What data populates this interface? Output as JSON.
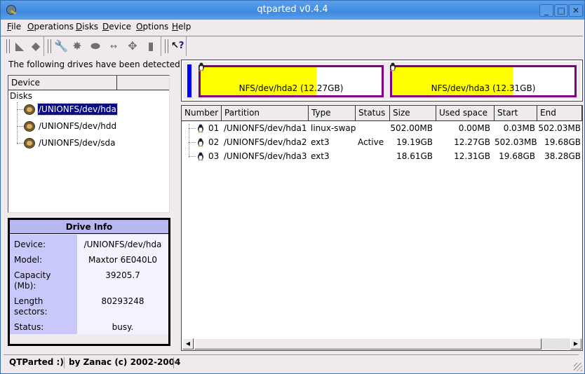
{
  "window": {
    "title": "qtparted v0.4.4",
    "controls": [
      "minimize",
      "maximize",
      "close"
    ]
  },
  "menubar": [
    {
      "label": "File",
      "mnemonic": "F",
      "rest": "ile"
    },
    {
      "label": "Operations",
      "mnemonic": "O",
      "rest": "perations"
    },
    {
      "label": "Disks",
      "mnemonic": "D",
      "rest": "isks"
    },
    {
      "label": "Device",
      "mnemonic": "D",
      "rest": "evice"
    },
    {
      "label": "Options",
      "mnemonic": "O",
      "rest": "ptions"
    },
    {
      "label": "Help",
      "mnemonic": "H",
      "rest": "elp"
    }
  ],
  "toolbar": {
    "groups": [
      [
        "undo-icon",
        "commit-icon"
      ],
      [
        "properties-icon",
        "create-icon",
        "format-icon",
        "resize-icon",
        "move-icon",
        "delete-icon"
      ],
      [
        "whats-this-icon"
      ]
    ]
  },
  "left": {
    "detected_label": "The following drives have been detected:",
    "tree_header": "Device",
    "tree_root": "Disks",
    "drives": [
      {
        "label": "/UNIONFS/dev/hda",
        "selected": true
      },
      {
        "label": "/UNIONFS/dev/hdd",
        "selected": false
      },
      {
        "label": "/UNIONFS/dev/sda",
        "selected": false
      }
    ]
  },
  "drive_info": {
    "title": "Drive Info",
    "rows": [
      {
        "label": "Device:",
        "value": "/UNIONFS/dev/hda"
      },
      {
        "label": "Model:",
        "value": "Maxtor 6E040L0"
      },
      {
        "label": "Capacity\n(Mb):",
        "value": "39205.7"
      },
      {
        "label": "Length\nsectors:",
        "value": "80293248"
      },
      {
        "label": "Status:",
        "value": "busy."
      }
    ]
  },
  "disk_map": {
    "partitions": [
      {
        "label": "NFS/dev/hda2 (12.27GB)",
        "used_fraction": 0.64
      },
      {
        "label": "NFS/dev/hda3 (12.31GB)",
        "used_fraction": 0.66
      }
    ],
    "colors": {
      "used": "#ffff00",
      "border": "#800080",
      "swap": "#0000ff"
    }
  },
  "partition_table": {
    "columns": [
      "Number",
      "Partition",
      "Type",
      "Status",
      "Size",
      "Used space",
      "Start",
      "End"
    ],
    "rows": [
      {
        "number": "01",
        "partition": "/UNIONFS/dev/hda1",
        "type": "linux-swap",
        "status": "",
        "size": "502.00MB",
        "used": "0.00MB",
        "start": "0.03MB",
        "end": "502.03MB"
      },
      {
        "number": "02",
        "partition": "/UNIONFS/dev/hda2",
        "type": "ext3",
        "status": "Active",
        "size": "19.19GB",
        "used": "12.27GB",
        "start": "502.03MB",
        "end": "19.68GB"
      },
      {
        "number": "03",
        "partition": "/UNIONFS/dev/hda3",
        "type": "ext3",
        "status": "",
        "size": "18.61GB",
        "used": "12.31GB",
        "start": "19.68GB",
        "end": "38.28GB"
      }
    ]
  },
  "statusbar": {
    "app": "QTParted :)",
    "credit": "by Zanac (c) 2002-2004"
  }
}
